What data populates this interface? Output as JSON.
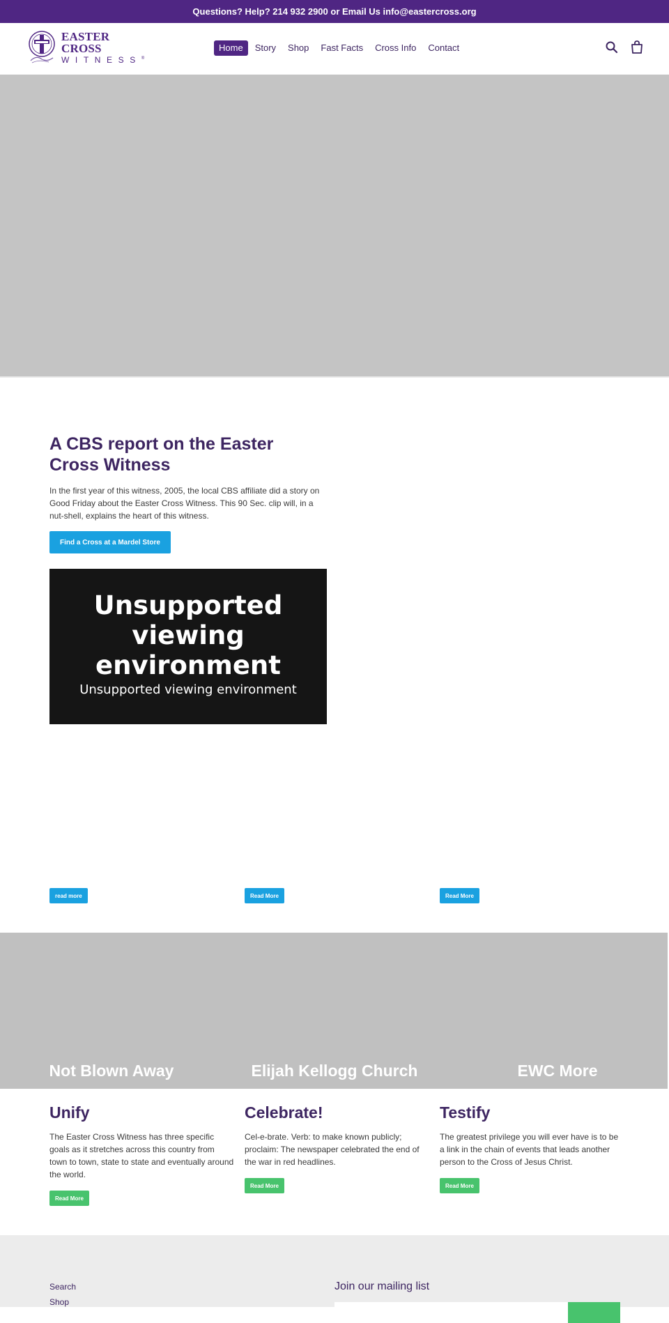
{
  "announcement": {
    "text": "Questions? Help? 214 932 2900 or Email Us info@eastercross.org"
  },
  "header": {
    "logo": {
      "line1": "EASTER CROSS",
      "line2": "WITNESS",
      "registered": "®"
    },
    "nav": [
      {
        "label": "Home",
        "active": true
      },
      {
        "label": "Story",
        "active": false
      },
      {
        "label": "Shop",
        "active": false
      },
      {
        "label": "Fast Facts",
        "active": false
      },
      {
        "label": "Cross Info",
        "active": false
      },
      {
        "label": "Contact",
        "active": false
      }
    ],
    "icons": [
      "search-icon",
      "cart-icon"
    ]
  },
  "cbs": {
    "title": "A CBS report on the Easter Cross Witness",
    "text": "In the first year of this witness, 2005, the local CBS affiliate did a story on Good Friday about the Easter Cross Witness. This 90 Sec. clip will, in a nut-shell, explains the heart of this witness.",
    "button": "Find a Cross at a Mardel Store",
    "video": {
      "main": "Unsupported viewing environment",
      "sub": "Unsupported viewing environment"
    }
  },
  "read_more_row": [
    "read more",
    "Read More",
    "Read More"
  ],
  "collection": [
    "Not Blown Away",
    "Elijah Kellogg Church",
    "EWC More"
  ],
  "features": [
    {
      "title": "Unify",
      "text": "The Easter Cross Witness has three specific goals as it stretches across this country from town to town, state to state and eventually around the world.",
      "button": "Read More"
    },
    {
      "title": "Celebrate!",
      "text": "Cel-e-brate. Verb: to make known publicly; proclaim: The newspaper celebrated the end of the war in red headlines.",
      "button": "Read More"
    },
    {
      "title": "Testify",
      "text": "The greatest privilege you will ever have is to be a link in the chain of events that leads another person to the Cross of Jesus Christ.",
      "button": "Read More"
    }
  ],
  "footer": {
    "links": [
      "Search",
      "Shop"
    ],
    "mailing_title": "Join our mailing list",
    "email_placeholder": "",
    "subscribe_label": ""
  },
  "colors": {
    "brand_purple": "#4f2683",
    "heading_purple": "#3d2561",
    "button_blue": "#1aa1e0",
    "button_green": "#48c36d"
  }
}
